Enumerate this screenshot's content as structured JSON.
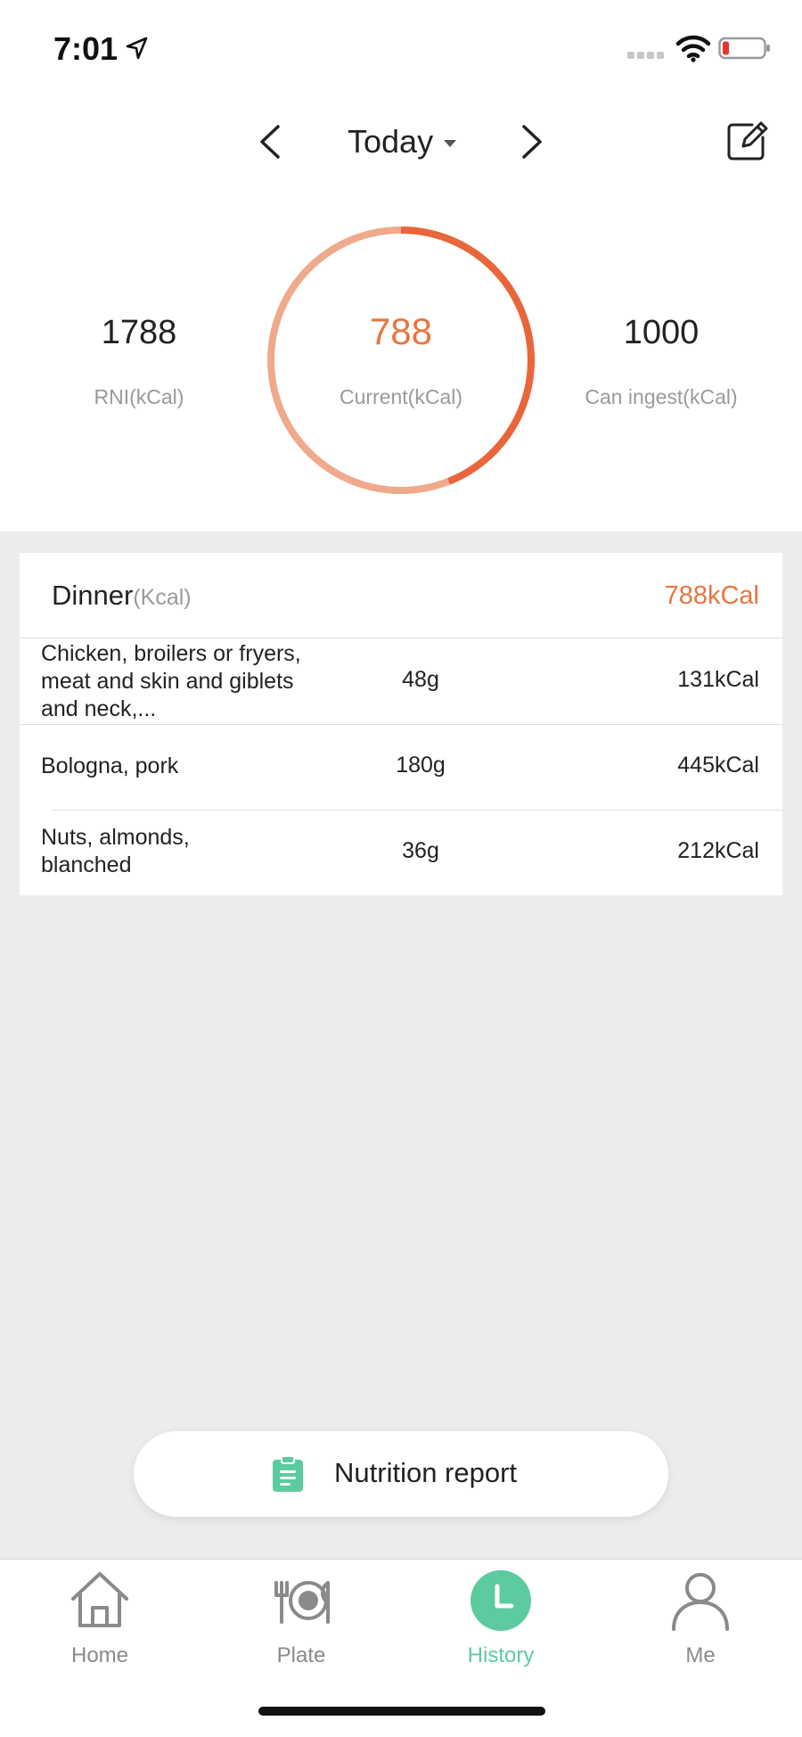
{
  "status_bar": {
    "time": "7:01"
  },
  "header": {
    "date_label": "Today"
  },
  "summary": {
    "rni_value": "1788",
    "rni_label": "RNI(kCal)",
    "current_value": "788",
    "current_label": "Current(kCal)",
    "can_ingest_value": "1000",
    "can_ingest_label": "Can ingest(kCal)",
    "progress_fraction": 0.44,
    "colors": {
      "accent": "#e8663a",
      "track": "#efa98d"
    }
  },
  "meal": {
    "title": "Dinner",
    "unit": "(Kcal)",
    "total": "788kCal",
    "items": [
      {
        "name": "Chicken, broilers or fryers, meat and skin and giblets and neck,...",
        "weight": "48g",
        "kcal": "131kCal"
      },
      {
        "name": "Bologna, pork",
        "weight": "180g",
        "kcal": "445kCal"
      },
      {
        "name": "Nuts, almonds, blanched",
        "weight": "36g",
        "kcal": "212kCal"
      }
    ]
  },
  "report_button": {
    "label": "Nutrition report",
    "icon": "clipboard-icon"
  },
  "tabbar": {
    "tabs": [
      {
        "label": "Home",
        "icon": "house-icon"
      },
      {
        "label": "Plate",
        "icon": "plate-icon"
      },
      {
        "label": "History",
        "icon": "clock-icon"
      },
      {
        "label": "Me",
        "icon": "person-icon"
      }
    ],
    "active_color": "#5ccb9f"
  }
}
